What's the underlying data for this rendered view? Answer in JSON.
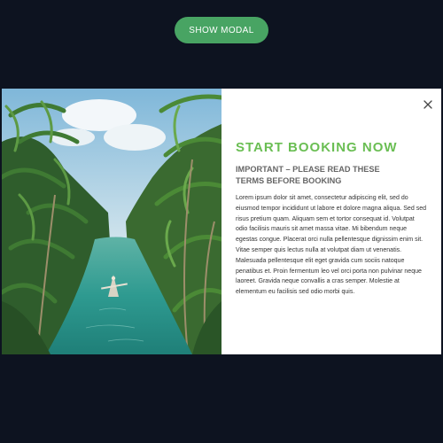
{
  "toolbar": {
    "show_modal_label": "SHOW MODAL",
    "button_color": "#48a463"
  },
  "modal": {
    "title": "START BOOKING NOW",
    "subtitle": "IMPORTANT – PLEASE READ THESE TERMS BEFORE BOOKING",
    "body": "Lorem ipsum dolor sit amet, consectetur adipiscing elit, sed do eiusmod tempor incididunt ut labore et dolore magna aliqua. Sed sed risus pretium quam. Aliquam sem et tortor consequat id. Volutpat odio facilisis mauris sit amet massa vitae. Mi bibendum neque egestas congue. Placerat orci nulla pellentesque dignissim enim sit. Vitae semper quis lectus nulla at volutpat diam ut venenatis. Malesuada pellentesque elit eget gravida cum sociis natoque penatibus et. Proin fermentum leo vel orci porta non pulvinar neque laoreet. Gravida neque convallis a cras semper. Molestie at elementum eu facilisis sed odio morbi quis.",
    "close_icon": "close-icon",
    "image": "river-with-palm-trees-and-boat",
    "title_color": "#6abe53"
  }
}
